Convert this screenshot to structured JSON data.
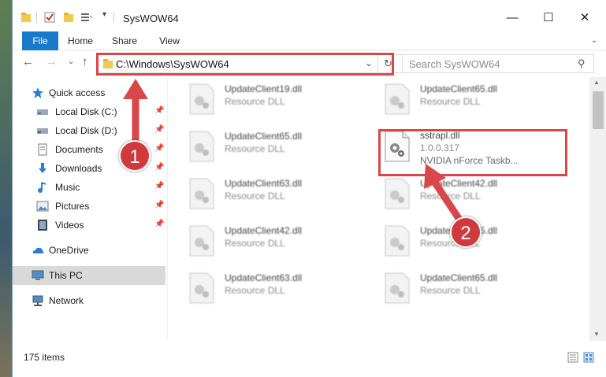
{
  "window": {
    "title": "SysWOW64"
  },
  "title_buttons": {
    "minimize": "—",
    "maximize": "☐",
    "close": "✕"
  },
  "ribbon": {
    "tabs": [
      "File",
      "Home",
      "Share",
      "View"
    ]
  },
  "nav": {
    "back": "←",
    "forward": "→",
    "recent": "⌄",
    "up": "↑",
    "address": "C:\\Windows\\SysWOW64",
    "address_dropdown": "⌄",
    "refresh": "↻",
    "search_placeholder": "Search SysWOW64",
    "search_icon": "⚲"
  },
  "sidebar": {
    "items": [
      {
        "label": "Quick access",
        "icon": "star-icon",
        "pinned": false
      },
      {
        "label": "Local Disk (C:)",
        "icon": "drive-icon",
        "pinned": true
      },
      {
        "label": "Local Disk (D:)",
        "icon": "drive-icon",
        "pinned": true
      },
      {
        "label": "Documents",
        "icon": "documents-icon",
        "pinned": true
      },
      {
        "label": "Downloads",
        "icon": "download-icon",
        "pinned": true
      },
      {
        "label": "Music",
        "icon": "music-icon",
        "pinned": true
      },
      {
        "label": "Pictures",
        "icon": "pictures-icon",
        "pinned": true
      },
      {
        "label": "Videos",
        "icon": "videos-icon",
        "pinned": true
      },
      {
        "label": "OneDrive",
        "icon": "onedrive-icon",
        "pinned": false
      },
      {
        "label": "This PC",
        "icon": "pc-icon",
        "pinned": false,
        "selected": true
      },
      {
        "label": "Network",
        "icon": "network-icon",
        "pinned": false
      }
    ],
    "pin_glyph": "📌"
  },
  "files": [
    {
      "name": "UpdateClient19.dll",
      "type": "Resource DLL"
    },
    {
      "name": "UpdateClient65.dll",
      "type": "Resource DLL"
    },
    {
      "name": "UpdateClient65.dll",
      "type": "Resource DLL"
    },
    {
      "name": "sstrapl.dll",
      "version": "1.0.0.317",
      "description": "NVIDIA nForce Taskb..."
    },
    {
      "name": "UpdateClient63.dll",
      "type": "Resource DLL"
    },
    {
      "name": "UpdateClient42.dll",
      "type": "Resource DLL"
    },
    {
      "name": "UpdateClient42.dll",
      "type": "Resource DLL"
    },
    {
      "name": "UpdateClient65.dll",
      "type": "Resource DLL"
    },
    {
      "name": "UpdateClient63.dll",
      "type": "Resource DLL"
    },
    {
      "name": "UpdateClient65.dll",
      "type": "Resource DLL"
    }
  ],
  "status": {
    "item_count": "175 items"
  },
  "annotations": {
    "badge1": "1",
    "badge2": "2",
    "color": "#d9474a"
  }
}
